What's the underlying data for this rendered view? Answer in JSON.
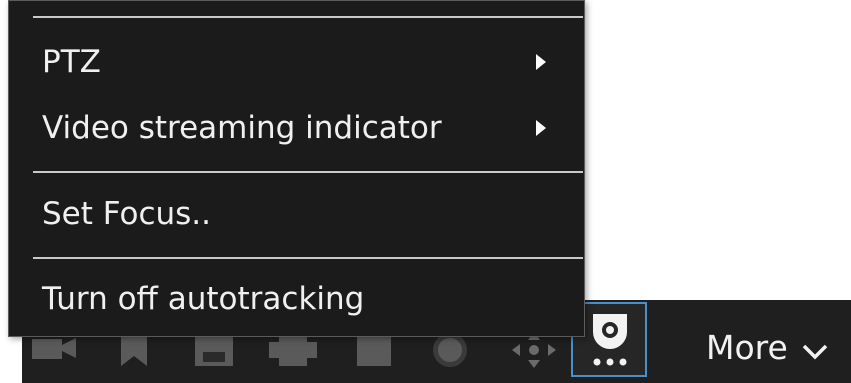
{
  "menu": {
    "items": [
      {
        "label": "PTZ",
        "has_submenu": true
      },
      {
        "label": "Video streaming indicator",
        "has_submenu": true
      },
      {
        "label": "Set Focus..",
        "has_submenu": false
      },
      {
        "label": "Turn off autotracking",
        "has_submenu": false
      }
    ]
  },
  "toolbar": {
    "buttons": [
      {
        "icon": "camera-icon"
      },
      {
        "icon": "bookmark-icon"
      },
      {
        "icon": "save-icon"
      },
      {
        "icon": "print-icon"
      },
      {
        "icon": "stop-icon"
      },
      {
        "icon": "record-icon"
      },
      {
        "icon": "ptz-move-icon"
      },
      {
        "icon": "autotracking-camera-icon",
        "selected": true
      }
    ],
    "more_label": "More"
  },
  "colors": {
    "menu_background": "#1b1b1b",
    "toolbar_background": "#1f1f1f",
    "selection_border": "#4a90c8",
    "text": "#f0f0f0"
  }
}
